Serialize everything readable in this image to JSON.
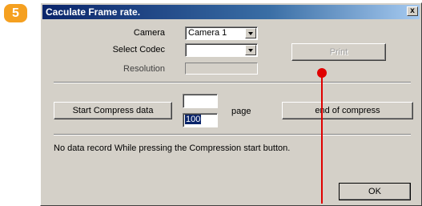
{
  "step_badge": "5",
  "dialog": {
    "title": "Caculate Frame rate.",
    "close_label": "x",
    "camera_label": "Camera",
    "camera_value": "Camera 1",
    "codec_label": "Select Codec",
    "codec_value": "",
    "resolution_label": "Resolution",
    "print_label": "Print",
    "start_compress_label": "Start Compress data",
    "page_from_value": "",
    "page_to_value": "100",
    "page_label": "page",
    "end_compress_label": "end of compress",
    "status_text": "No data record While pressing the Compression start button.",
    "ok_label": "OK"
  },
  "colors": {
    "marker": "#e00000",
    "badge": "#f5a020",
    "title_bar": "#0a246a"
  }
}
